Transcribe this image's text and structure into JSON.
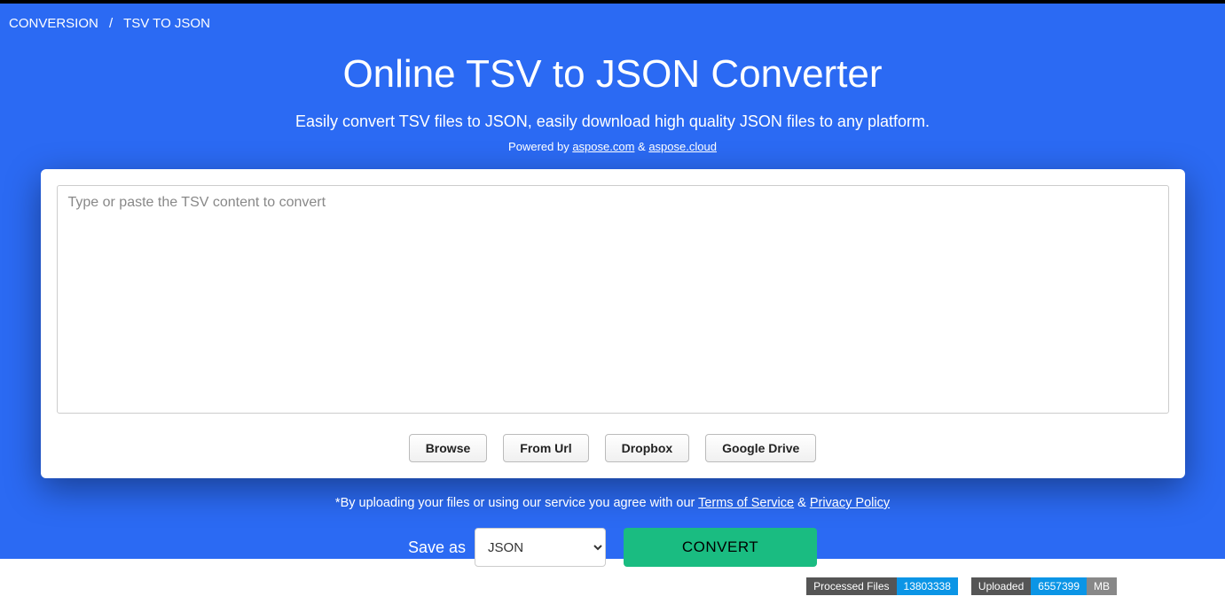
{
  "breadcrumb": {
    "item1": "CONVERSION",
    "separator": "/",
    "item2": "TSV TO JSON"
  },
  "header": {
    "title": "Online TSV to JSON Converter",
    "subtitle": "Easily convert TSV files to JSON, easily download high quality JSON files to any platform.",
    "powered_prefix": "Powered by ",
    "link1": "aspose.com",
    "amp": " & ",
    "link2": "aspose.cloud"
  },
  "input": {
    "placeholder": "Type or paste the TSV content to convert",
    "value": ""
  },
  "buttons": {
    "browse": "Browse",
    "from_url": "From Url",
    "dropbox": "Dropbox",
    "google_drive": "Google Drive"
  },
  "terms": {
    "prefix": "*By uploading your files or using our service you agree with our ",
    "tos": "Terms of Service",
    "amp": " & ",
    "privacy": "Privacy Policy"
  },
  "save": {
    "label": "Save as",
    "selected": "JSON",
    "convert": "CONVERT"
  },
  "stats": {
    "processed_label": "Processed Files",
    "processed_value": "13803338",
    "uploaded_label": "Uploaded",
    "uploaded_value": "6557399",
    "uploaded_unit": "MB"
  }
}
